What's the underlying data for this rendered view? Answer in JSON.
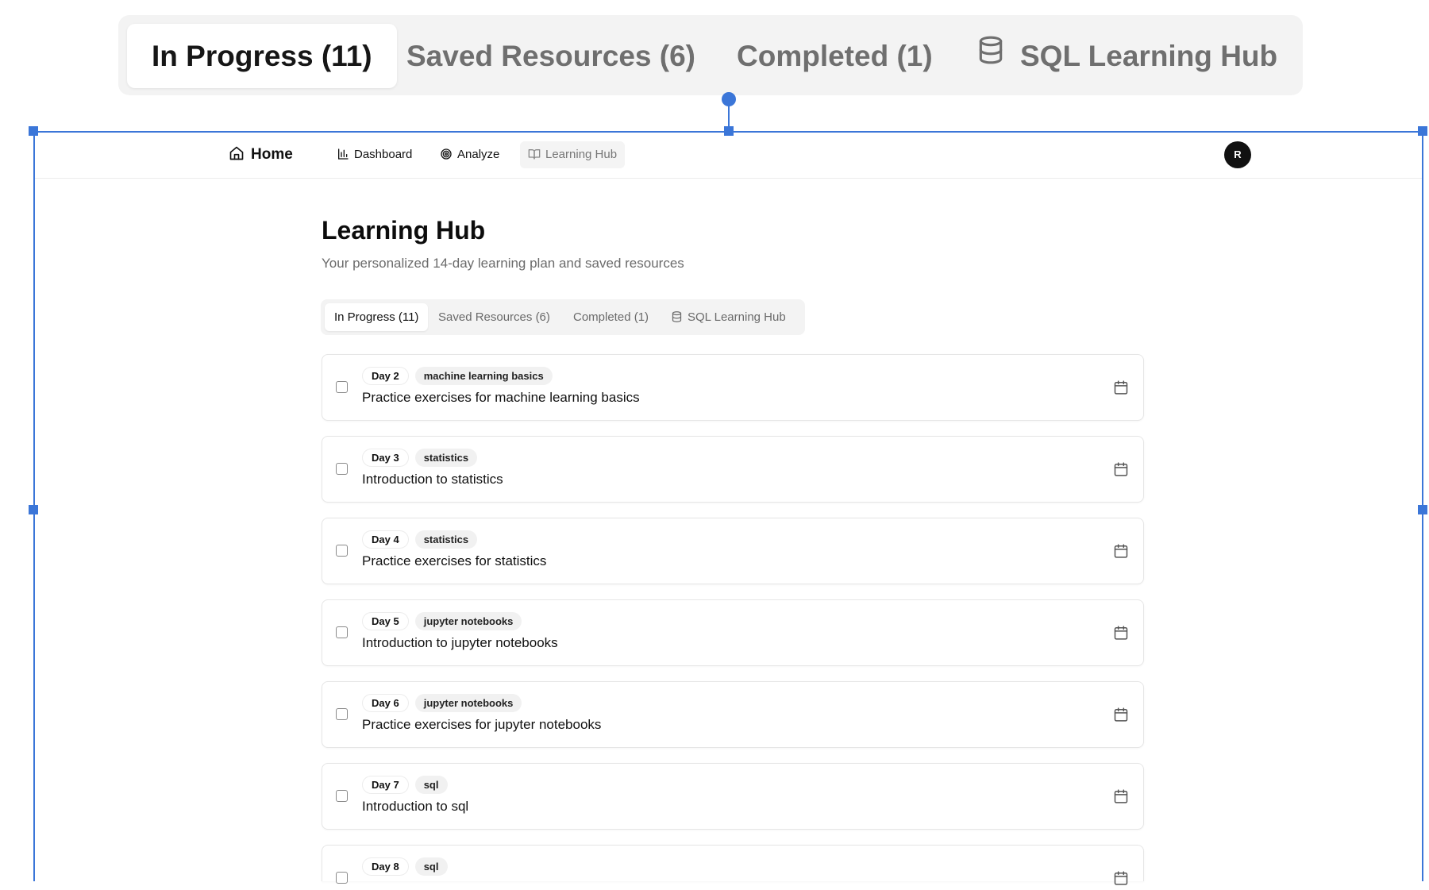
{
  "zoomed_tabs": [
    {
      "label": "In Progress (11)",
      "active": true
    },
    {
      "label": "Saved Resources (6)",
      "active": false
    },
    {
      "label": "Completed (1)",
      "active": false
    },
    {
      "label": "SQL Learning Hub",
      "active": false,
      "icon": "database-icon"
    }
  ],
  "nav": {
    "home": "Home",
    "items": [
      {
        "label": "Dashboard",
        "icon": "bar-chart-icon"
      },
      {
        "label": "Analyze",
        "icon": "target-icon"
      },
      {
        "label": "Learning Hub",
        "icon": "book-open-icon",
        "current": true
      }
    ],
    "avatar_initial": "R"
  },
  "page": {
    "title": "Learning Hub",
    "subtitle": "Your personalized 14-day learning plan and saved resources"
  },
  "tabs": [
    {
      "label": "In Progress (11)",
      "active": true
    },
    {
      "label": "Saved Resources (6)",
      "active": false
    },
    {
      "label": "Completed (1)",
      "active": false
    },
    {
      "label": "SQL Learning Hub",
      "active": false,
      "icon": "database-icon"
    }
  ],
  "tasks": [
    {
      "day": "Day 2",
      "topic": "machine learning basics",
      "title": "Practice exercises for machine learning basics",
      "checked": false
    },
    {
      "day": "Day 3",
      "topic": "statistics",
      "title": "Introduction to statistics",
      "checked": false
    },
    {
      "day": "Day 4",
      "topic": "statistics",
      "title": "Practice exercises for statistics",
      "checked": false
    },
    {
      "day": "Day 5",
      "topic": "jupyter notebooks",
      "title": "Introduction to jupyter notebooks",
      "checked": false
    },
    {
      "day": "Day 6",
      "topic": "jupyter notebooks",
      "title": "Practice exercises for jupyter notebooks",
      "checked": false
    },
    {
      "day": "Day 7",
      "topic": "sql",
      "title": "Introduction to sql",
      "checked": false
    },
    {
      "day": "Day 8",
      "topic": "sql",
      "title": "",
      "checked": false
    }
  ],
  "colors": {
    "selection": "#3b76d8",
    "avatar_bg": "#111111"
  }
}
